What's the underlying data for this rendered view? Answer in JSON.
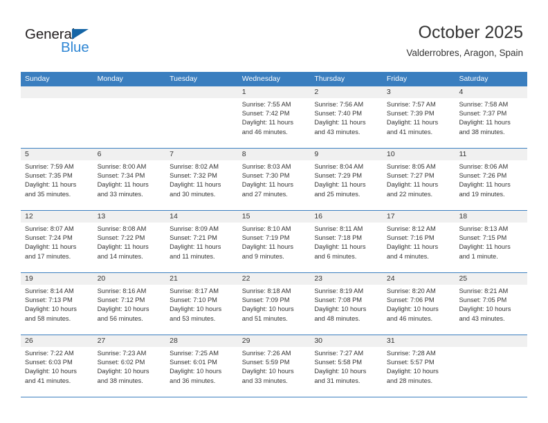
{
  "brand": {
    "name_part1": "General",
    "name_part2": "Blue",
    "accent_color": "#2e86d4",
    "triangle_color": "#1565a6"
  },
  "header": {
    "title": "October 2025",
    "location": "Valderrobres, Aragon, Spain"
  },
  "calendar": {
    "header_bg": "#3a7ebf",
    "daynum_bg": "#f0f0f0",
    "weekdays": [
      "Sunday",
      "Monday",
      "Tuesday",
      "Wednesday",
      "Thursday",
      "Friday",
      "Saturday"
    ],
    "weeks": [
      [
        {
          "day": "",
          "sunrise": "",
          "sunset": "",
          "daylight1": "",
          "daylight2": ""
        },
        {
          "day": "",
          "sunrise": "",
          "sunset": "",
          "daylight1": "",
          "daylight2": ""
        },
        {
          "day": "",
          "sunrise": "",
          "sunset": "",
          "daylight1": "",
          "daylight2": ""
        },
        {
          "day": "1",
          "sunrise": "Sunrise: 7:55 AM",
          "sunset": "Sunset: 7:42 PM",
          "daylight1": "Daylight: 11 hours",
          "daylight2": "and 46 minutes."
        },
        {
          "day": "2",
          "sunrise": "Sunrise: 7:56 AM",
          "sunset": "Sunset: 7:40 PM",
          "daylight1": "Daylight: 11 hours",
          "daylight2": "and 43 minutes."
        },
        {
          "day": "3",
          "sunrise": "Sunrise: 7:57 AM",
          "sunset": "Sunset: 7:39 PM",
          "daylight1": "Daylight: 11 hours",
          "daylight2": "and 41 minutes."
        },
        {
          "day": "4",
          "sunrise": "Sunrise: 7:58 AM",
          "sunset": "Sunset: 7:37 PM",
          "daylight1": "Daylight: 11 hours",
          "daylight2": "and 38 minutes."
        }
      ],
      [
        {
          "day": "5",
          "sunrise": "Sunrise: 7:59 AM",
          "sunset": "Sunset: 7:35 PM",
          "daylight1": "Daylight: 11 hours",
          "daylight2": "and 35 minutes."
        },
        {
          "day": "6",
          "sunrise": "Sunrise: 8:00 AM",
          "sunset": "Sunset: 7:34 PM",
          "daylight1": "Daylight: 11 hours",
          "daylight2": "and 33 minutes."
        },
        {
          "day": "7",
          "sunrise": "Sunrise: 8:02 AM",
          "sunset": "Sunset: 7:32 PM",
          "daylight1": "Daylight: 11 hours",
          "daylight2": "and 30 minutes."
        },
        {
          "day": "8",
          "sunrise": "Sunrise: 8:03 AM",
          "sunset": "Sunset: 7:30 PM",
          "daylight1": "Daylight: 11 hours",
          "daylight2": "and 27 minutes."
        },
        {
          "day": "9",
          "sunrise": "Sunrise: 8:04 AM",
          "sunset": "Sunset: 7:29 PM",
          "daylight1": "Daylight: 11 hours",
          "daylight2": "and 25 minutes."
        },
        {
          "day": "10",
          "sunrise": "Sunrise: 8:05 AM",
          "sunset": "Sunset: 7:27 PM",
          "daylight1": "Daylight: 11 hours",
          "daylight2": "and 22 minutes."
        },
        {
          "day": "11",
          "sunrise": "Sunrise: 8:06 AM",
          "sunset": "Sunset: 7:26 PM",
          "daylight1": "Daylight: 11 hours",
          "daylight2": "and 19 minutes."
        }
      ],
      [
        {
          "day": "12",
          "sunrise": "Sunrise: 8:07 AM",
          "sunset": "Sunset: 7:24 PM",
          "daylight1": "Daylight: 11 hours",
          "daylight2": "and 17 minutes."
        },
        {
          "day": "13",
          "sunrise": "Sunrise: 8:08 AM",
          "sunset": "Sunset: 7:22 PM",
          "daylight1": "Daylight: 11 hours",
          "daylight2": "and 14 minutes."
        },
        {
          "day": "14",
          "sunrise": "Sunrise: 8:09 AM",
          "sunset": "Sunset: 7:21 PM",
          "daylight1": "Daylight: 11 hours",
          "daylight2": "and 11 minutes."
        },
        {
          "day": "15",
          "sunrise": "Sunrise: 8:10 AM",
          "sunset": "Sunset: 7:19 PM",
          "daylight1": "Daylight: 11 hours",
          "daylight2": "and 9 minutes."
        },
        {
          "day": "16",
          "sunrise": "Sunrise: 8:11 AM",
          "sunset": "Sunset: 7:18 PM",
          "daylight1": "Daylight: 11 hours",
          "daylight2": "and 6 minutes."
        },
        {
          "day": "17",
          "sunrise": "Sunrise: 8:12 AM",
          "sunset": "Sunset: 7:16 PM",
          "daylight1": "Daylight: 11 hours",
          "daylight2": "and 4 minutes."
        },
        {
          "day": "18",
          "sunrise": "Sunrise: 8:13 AM",
          "sunset": "Sunset: 7:15 PM",
          "daylight1": "Daylight: 11 hours",
          "daylight2": "and 1 minute."
        }
      ],
      [
        {
          "day": "19",
          "sunrise": "Sunrise: 8:14 AM",
          "sunset": "Sunset: 7:13 PM",
          "daylight1": "Daylight: 10 hours",
          "daylight2": "and 58 minutes."
        },
        {
          "day": "20",
          "sunrise": "Sunrise: 8:16 AM",
          "sunset": "Sunset: 7:12 PM",
          "daylight1": "Daylight: 10 hours",
          "daylight2": "and 56 minutes."
        },
        {
          "day": "21",
          "sunrise": "Sunrise: 8:17 AM",
          "sunset": "Sunset: 7:10 PM",
          "daylight1": "Daylight: 10 hours",
          "daylight2": "and 53 minutes."
        },
        {
          "day": "22",
          "sunrise": "Sunrise: 8:18 AM",
          "sunset": "Sunset: 7:09 PM",
          "daylight1": "Daylight: 10 hours",
          "daylight2": "and 51 minutes."
        },
        {
          "day": "23",
          "sunrise": "Sunrise: 8:19 AM",
          "sunset": "Sunset: 7:08 PM",
          "daylight1": "Daylight: 10 hours",
          "daylight2": "and 48 minutes."
        },
        {
          "day": "24",
          "sunrise": "Sunrise: 8:20 AM",
          "sunset": "Sunset: 7:06 PM",
          "daylight1": "Daylight: 10 hours",
          "daylight2": "and 46 minutes."
        },
        {
          "day": "25",
          "sunrise": "Sunrise: 8:21 AM",
          "sunset": "Sunset: 7:05 PM",
          "daylight1": "Daylight: 10 hours",
          "daylight2": "and 43 minutes."
        }
      ],
      [
        {
          "day": "26",
          "sunrise": "Sunrise: 7:22 AM",
          "sunset": "Sunset: 6:03 PM",
          "daylight1": "Daylight: 10 hours",
          "daylight2": "and 41 minutes."
        },
        {
          "day": "27",
          "sunrise": "Sunrise: 7:23 AM",
          "sunset": "Sunset: 6:02 PM",
          "daylight1": "Daylight: 10 hours",
          "daylight2": "and 38 minutes."
        },
        {
          "day": "28",
          "sunrise": "Sunrise: 7:25 AM",
          "sunset": "Sunset: 6:01 PM",
          "daylight1": "Daylight: 10 hours",
          "daylight2": "and 36 minutes."
        },
        {
          "day": "29",
          "sunrise": "Sunrise: 7:26 AM",
          "sunset": "Sunset: 5:59 PM",
          "daylight1": "Daylight: 10 hours",
          "daylight2": "and 33 minutes."
        },
        {
          "day": "30",
          "sunrise": "Sunrise: 7:27 AM",
          "sunset": "Sunset: 5:58 PM",
          "daylight1": "Daylight: 10 hours",
          "daylight2": "and 31 minutes."
        },
        {
          "day": "31",
          "sunrise": "Sunrise: 7:28 AM",
          "sunset": "Sunset: 5:57 PM",
          "daylight1": "Daylight: 10 hours",
          "daylight2": "and 28 minutes."
        },
        {
          "day": "",
          "sunrise": "",
          "sunset": "",
          "daylight1": "",
          "daylight2": ""
        }
      ]
    ]
  }
}
